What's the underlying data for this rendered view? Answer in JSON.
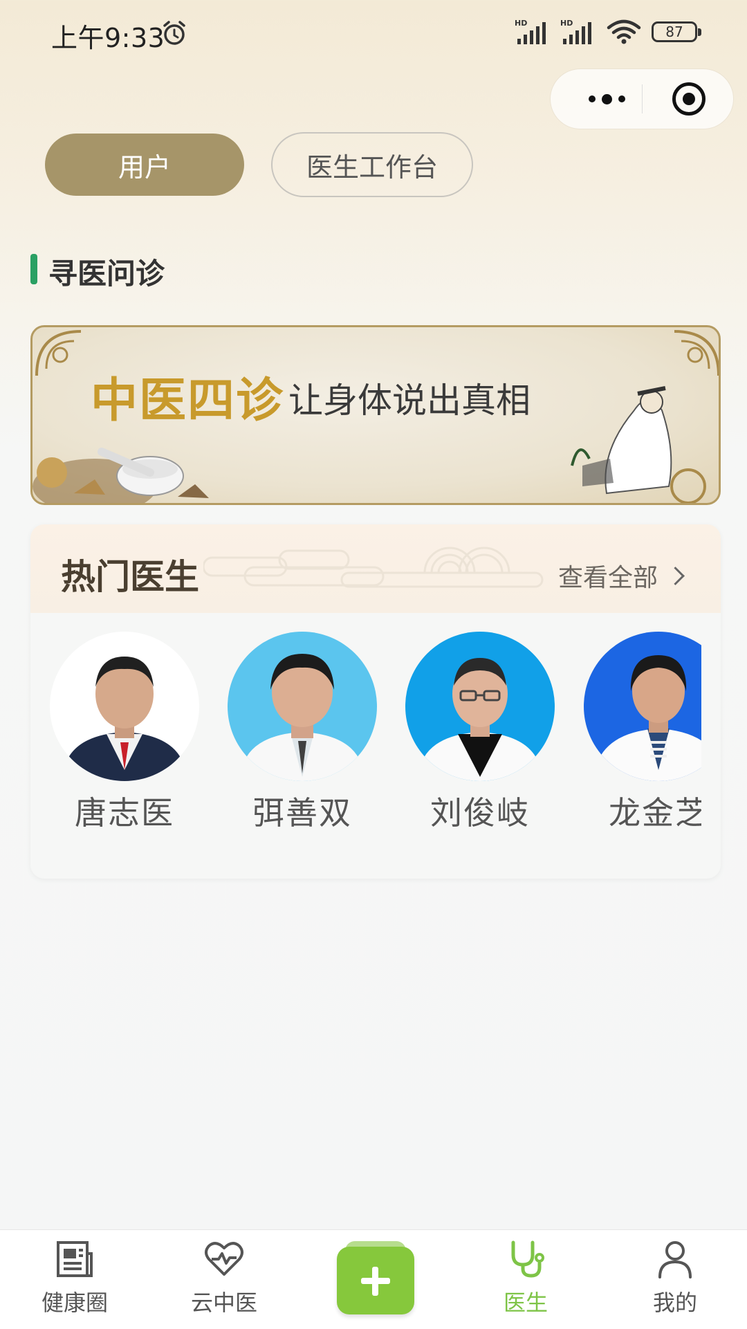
{
  "status_bar": {
    "time": "上午9:33",
    "battery": "87",
    "signal_tag": "HD"
  },
  "segments": {
    "user": "用户",
    "doctor_workbench": "医生工作台"
  },
  "section": {
    "title": "寻医问诊"
  },
  "banner": {
    "title": "中医四诊",
    "subtitle": "让身体说出真相"
  },
  "hot_doctors": {
    "title": "热门医生",
    "view_all": "查看全部",
    "doctors": [
      {
        "name": "唐志医",
        "bg": "#ffffff"
      },
      {
        "name": "弭善双",
        "bg": "#5bc5ee"
      },
      {
        "name": "刘俊岐",
        "bg": "#11a0e8"
      },
      {
        "name": "龙金芝",
        "bg": "#1c66e3"
      }
    ]
  },
  "tabbar": {
    "items": [
      {
        "label": "健康圈",
        "icon": "newspaper-icon"
      },
      {
        "label": "云中医",
        "icon": "heart-pulse-icon"
      },
      {
        "label": "",
        "icon": "plus-icon"
      },
      {
        "label": "医生",
        "icon": "stethoscope-icon",
        "active": true
      },
      {
        "label": "我的",
        "icon": "user-icon"
      }
    ],
    "active_color": "#7ec447"
  },
  "colors": {
    "accent": "#a69569",
    "green": "#86c83c",
    "section_bar": "#2aa063"
  }
}
